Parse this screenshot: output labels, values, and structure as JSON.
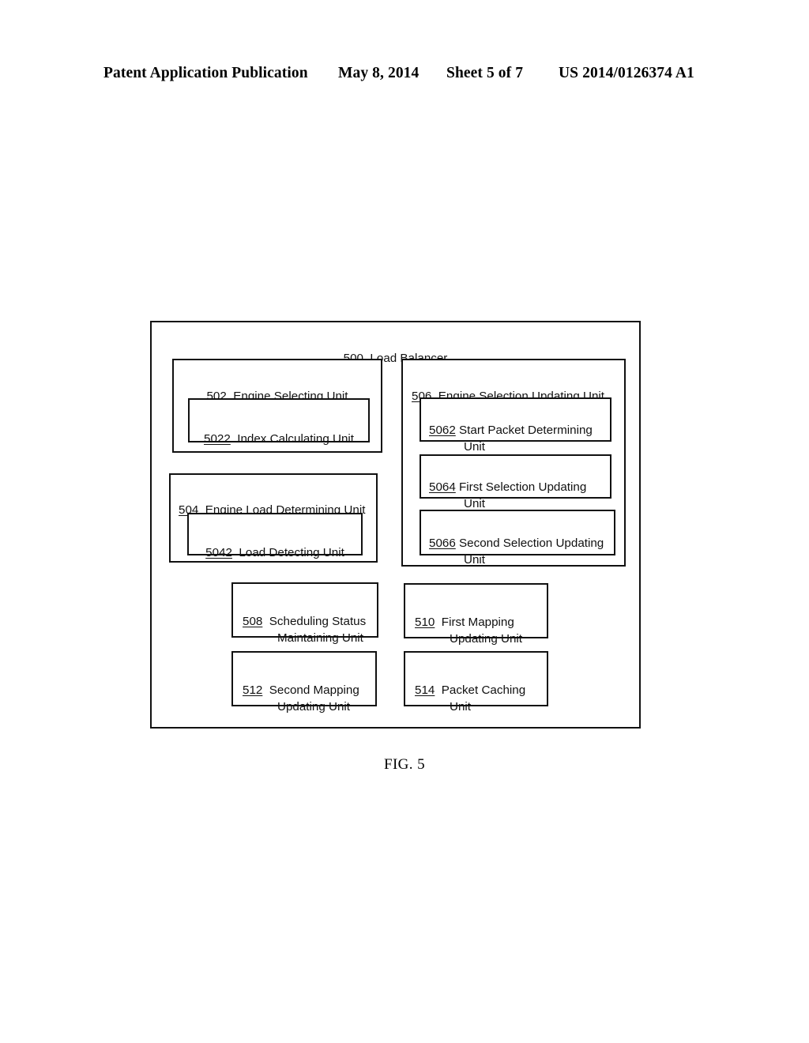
{
  "header": {
    "publication": "Patent Application Publication",
    "date": "May 8, 2014",
    "sheet": "Sheet 5 of 7",
    "publication_number": "US 2014/0126374 A1"
  },
  "figure": {
    "caption": "FIG. 5",
    "root": {
      "ref": "500",
      "label": "Load Balancer"
    },
    "blocks": {
      "engine_selecting": {
        "ref": "502",
        "label": "Engine Selecting Unit",
        "child": {
          "ref": "5022",
          "label": "Index Calculating Unit"
        }
      },
      "engine_load_determining": {
        "ref": "504",
        "label": "Engine Load Determining Unit",
        "child": {
          "ref": "5042",
          "label": "Load Detecting Unit"
        }
      },
      "engine_selection_updating": {
        "ref": "506",
        "label": "Engine Selection Updating Unit",
        "children": [
          {
            "ref": "5062",
            "label_line1": "Start Packet Determining",
            "label_line2": "Unit"
          },
          {
            "ref": "5064",
            "label_line1": "First Selection Updating",
            "label_line2": "Unit"
          },
          {
            "ref": "5066",
            "label_line1": "Second Selection Updating",
            "label_line2": "Unit"
          }
        ]
      },
      "scheduling_status_maintaining": {
        "ref": "508",
        "label_line1": "Scheduling Status",
        "label_line2": "Maintaining Unit"
      },
      "first_mapping_updating": {
        "ref": "510",
        "label_line1": "First Mapping",
        "label_line2": "Updating Unit"
      },
      "second_mapping_updating": {
        "ref": "512",
        "label_line1": "Second Mapping",
        "label_line2": "Updating Unit"
      },
      "packet_caching": {
        "ref": "514",
        "label_line1": "Packet Caching",
        "label_line2": "Unit"
      }
    }
  }
}
